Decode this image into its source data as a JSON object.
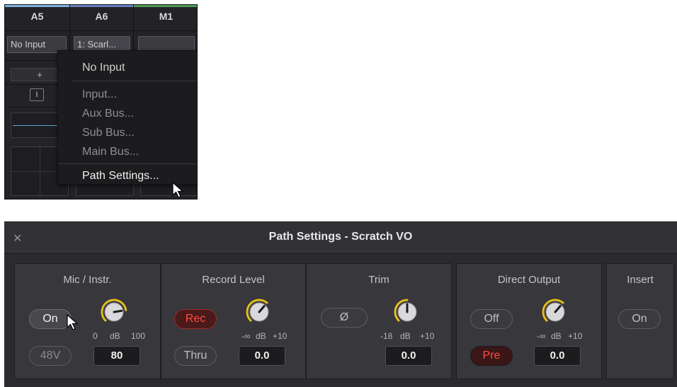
{
  "mixer": {
    "channels": [
      {
        "name": "A5",
        "input": "No Input",
        "accent": "#7fb2e0"
      },
      {
        "name": "A6",
        "input": "1: Scarl...",
        "accent": "#6a7fc0"
      },
      {
        "name": "M1",
        "input": "",
        "accent": "#4d9d5a"
      }
    ],
    "add_label": "+",
    "slot_label": "I",
    "dropdown": {
      "items": [
        {
          "label": "No Input"
        },
        {
          "label": "Input..."
        },
        {
          "label": "Aux Bus..."
        },
        {
          "label": "Sub Bus..."
        },
        {
          "label": "Main Bus..."
        },
        {
          "label": "Path Settings..."
        }
      ]
    }
  },
  "panel": {
    "title": "Path Settings - Scratch VO",
    "close_icon": "close-icon",
    "sections": {
      "mic": {
        "title": "Mic / Instr.",
        "on_label": "On",
        "phantom_label": "48V",
        "scale": {
          "min": "0",
          "unit": "dB",
          "max": "100"
        },
        "value": "80",
        "knob_level": 0.8
      },
      "record": {
        "title": "Record Level",
        "rec_label": "Rec",
        "thru_label": "Thru",
        "scale": {
          "min": "-∞",
          "unit": "dB",
          "max": "+10"
        },
        "value": "0.0",
        "knob_level": 0.65
      },
      "trim": {
        "title": "Trim",
        "phase_label": "Ø",
        "scale": {
          "min": "-18",
          "unit": "dB",
          "max": "+10"
        },
        "value": "0.0",
        "knob_level": 0.5
      },
      "direct": {
        "title": "Direct Output",
        "off_label": "Off",
        "pre_label": "Pre",
        "scale": {
          "min": "-∞",
          "unit": "dB",
          "max": "+10"
        },
        "value": "0.0",
        "knob_level": 0.65
      },
      "insert": {
        "title": "Insert",
        "on_label": "On"
      }
    }
  },
  "colors": {
    "knob_arc": "#e3bd1e",
    "rec_red": "#ff4b45"
  }
}
